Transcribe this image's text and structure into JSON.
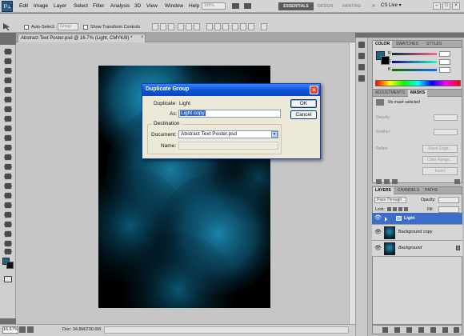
{
  "app": {
    "logo": "Ps",
    "menu": [
      "File",
      "Edit",
      "Image",
      "Layer",
      "Select",
      "Filter",
      "Analysis",
      "3D",
      "View",
      "Window",
      "Help"
    ],
    "zoom_select": "100%",
    "workspaces": {
      "essentials": "ESSENTIALS",
      "design": "DESIGN",
      "painting": "PAINTING",
      "more": "»"
    },
    "cs_live": "CS Live ▾",
    "window_controls": [
      "–",
      "□",
      "×"
    ]
  },
  "options_bar": {
    "auto_select_label": "Auto-Select:",
    "auto_select_value": "Group",
    "show_transform_label": "Show Transform Controls"
  },
  "document": {
    "tab_title": "Abstract Text Poster.psd @ 16.7% (Light, CMYK/8) *",
    "tab_close": "×",
    "zoom": "16.67%",
    "doc_info": "Doc: 34.8M/230.6M"
  },
  "dialog": {
    "title": "Duplicate Group",
    "duplicate_label": "Duplicate:",
    "duplicate_value": "Light",
    "as_label": "As:",
    "as_value": "Light copy",
    "ok_label": "OK",
    "cancel_label": "Cancel",
    "destination_label": "Destination",
    "document_label": "Document:",
    "document_value": "Abstract Text Poster.psd",
    "name_label": "Name:",
    "close_symbol": "×"
  },
  "color_panel": {
    "tabs": [
      "COLOR",
      "SWATCHES",
      "STYLES"
    ],
    "labels": [
      "R",
      "G",
      "B"
    ],
    "colors": {
      "foreground": "#1a6a86",
      "background": "#000000"
    }
  },
  "adjustments_panel": {
    "tabs": [
      "ADJUSTMENTS",
      "MASKS"
    ],
    "no_mask": "No mask selected",
    "density_label": "Density:",
    "feather_label": "Feather:",
    "refine_label": "Refine:",
    "mask_edge": "Mask Edge...",
    "color_range": "Color Range...",
    "invert": "Invert"
  },
  "layers_panel": {
    "tabs": [
      "LAYERS",
      "CHANNELS",
      "PATHS"
    ],
    "blend_mode": "Pass Through",
    "opacity_label": "Opacity:",
    "lock_label": "Lock:",
    "fill_label": "Fill:",
    "layers": [
      {
        "name": "Light",
        "selected": true,
        "is_group": true
      },
      {
        "name": "Background copy",
        "selected": false
      },
      {
        "name": "Background",
        "selected": false,
        "locked": true
      }
    ]
  },
  "canvas": {
    "colors": {
      "accent": "#1fa3d1",
      "base": "#000000"
    }
  }
}
